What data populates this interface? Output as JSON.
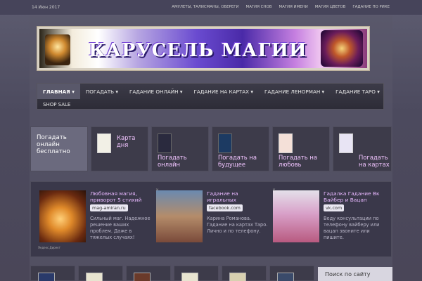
{
  "topbar": {
    "date": "14 Июн 2017",
    "links": [
      "АМУЛЕТЫ, ТАЛИСМАНЫ, ОБЕРЕГИ",
      "МАГИЯ СНОВ",
      "МАГИЯ ИМЕНИ",
      "МАГИЯ ЦВЕТОВ",
      "ГАДАНИЕ ПО РИКЕ"
    ]
  },
  "banner": {
    "title": "КАРУСЕЛЬ МАГИИ"
  },
  "nav": {
    "items": [
      {
        "label": "ГЛАВНАЯ ▾"
      },
      {
        "label": "ПОГАДАТЬ ▾"
      },
      {
        "label": "ГАДАНИЕ ОНЛАЙН ▾"
      },
      {
        "label": "ГАДАНИЕ НА КАРТАХ ▾"
      },
      {
        "label": "ГАДАНИЕ ЛЕНОРМАН ▾"
      },
      {
        "label": "ГАДАНИЕ ТАРО ▾"
      }
    ],
    "second_row": "SHOP SALE"
  },
  "tiles": [
    {
      "label": "Погадать онлайн бесплатно"
    },
    {
      "label": "Карта дня"
    },
    {
      "label": "Погадать онлайн"
    },
    {
      "label": "Погадать на будущее"
    },
    {
      "label": "Погадать на любовь"
    },
    {
      "label": "Погадать на картах"
    }
  ],
  "cards": [
    {
      "title": "Любовная магия, приворот 5 стихий",
      "source": "mag-amiran.ru",
      "desc": "Сильный маг. Надежное решение ваших проблем. Даже в тяжелых случаях!"
    },
    {
      "title": "Гадание на игральных",
      "source": "facebook.com",
      "desc": "Карина Романова. Гадание на картах Таро. Лично и по телефону."
    },
    {
      "title": "Гадалка Гадание Вк Вайбер и Вацап",
      "source": "vk.com",
      "desc": "Веду консультации по телефону вайберу или вацап звоните или пишите."
    }
  ],
  "credit": "Яндекс.Директ",
  "search": {
    "label": "Поиск по сайту"
  },
  "colors": {
    "accent": "#e8b8ff",
    "background": "#4c4a5e"
  }
}
